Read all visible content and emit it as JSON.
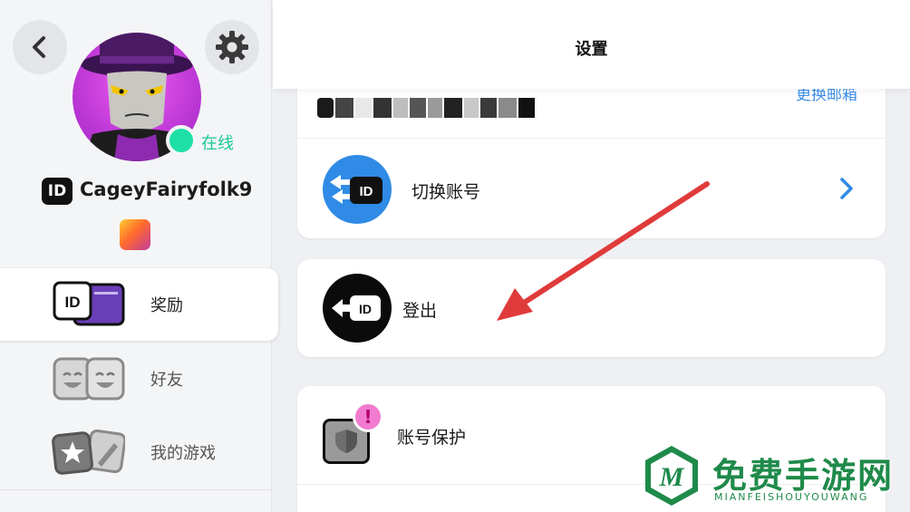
{
  "sidebar": {
    "status_text": "在线",
    "id_badge": "ID",
    "username": "CageyFairyfolk9",
    "menu": [
      {
        "label": "奖励",
        "icon": "id-card-icon",
        "active": true
      },
      {
        "label": "好友",
        "icon": "friends-icon",
        "active": false
      },
      {
        "label": "我的游戏",
        "icon": "games-icon",
        "active": false
      }
    ]
  },
  "header": {
    "title": "设置"
  },
  "settings": {
    "partial_link": "更换邮箱",
    "switch_account": "切换账号",
    "logout": "登出",
    "account_protection": "账号保护",
    "id_tag": "ID",
    "alert_mark": "!"
  },
  "watermark": {
    "title": "免费手游网",
    "subtitle": "MIANFEISHOUYOUWANG",
    "logo_letter": "M"
  },
  "colors": {
    "accent_blue": "#2f8be6",
    "online_green": "#1ee0a6",
    "annotation_red": "#e03b3b",
    "watermark_green": "#1f8a4a"
  }
}
